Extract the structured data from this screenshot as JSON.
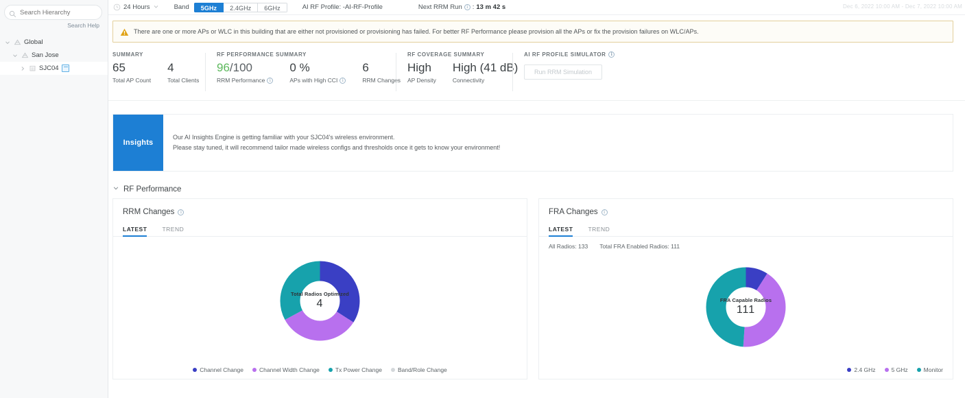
{
  "sidebar": {
    "search": {
      "placeholder": "Search Hierarchy",
      "value": ""
    },
    "search_help": "Search Help",
    "tree": [
      {
        "label": "Global",
        "icon": "site-icon",
        "expanded": true
      },
      {
        "label": "San Jose",
        "icon": "site-icon",
        "expanded": true
      },
      {
        "label": "SJC04",
        "icon": "building-icon",
        "expanded": false,
        "selected": true,
        "badge": "floor-plan-badge"
      }
    ]
  },
  "topbar": {
    "time_range": "24 Hours",
    "band_label": "Band",
    "bands": [
      {
        "label": "5GHz",
        "active": true
      },
      {
        "label": "2.4GHz",
        "active": false
      },
      {
        "label": "6GHz",
        "active": false
      }
    ],
    "profile": "AI RF Profile: -AI-RF-Profile",
    "next_run_label": "Next RRM Run",
    "next_run_sep": ":",
    "next_run_value": "13 m 42 s",
    "timestamp": "Dec 6, 2022 10:00 AM - Dec 7, 2022 10:00 AM"
  },
  "warning": {
    "text": "There are one or more APs or WLC in this building that are either not provisioned or provisioning has failed. For better RF Performance please provision all the APs or fix the provision failures on WLC/APs."
  },
  "summary": {
    "title": "SUMMARY",
    "metrics": [
      {
        "value": "65",
        "label": "Total AP Count"
      },
      {
        "value": "4",
        "label": "Total Clients"
      }
    ]
  },
  "rf_performance_summary": {
    "title": "RF PERFORMANCE SUMMARY",
    "metrics": [
      {
        "value": "96",
        "suffix": "/100",
        "label": "RRM Performance",
        "info": true
      },
      {
        "value": "0 %",
        "label": "APs with High CCI",
        "info": true
      },
      {
        "value": "6",
        "label": "RRM Changes",
        "info": false
      }
    ]
  },
  "rf_coverage_summary": {
    "title": "RF COVERAGE SUMMARY",
    "metrics": [
      {
        "value": "High",
        "label": "AP Density"
      },
      {
        "value": "High (41 dB)",
        "label": "Connectivity"
      }
    ]
  },
  "simulator": {
    "title": "AI RF PROFILE SIMULATOR",
    "button": "Run RRM Simulation",
    "disabled": true
  },
  "insights": {
    "tab_label": "Insights",
    "line1": "Our AI Insights Engine is getting familiar with your SJC04's wireless environment.",
    "line2": "Please stay tuned, it will recommend tailor made wireless configs and thresholds once it gets to know your environment!"
  },
  "section": {
    "title": "RF Performance"
  },
  "rrm_card": {
    "title": "RRM Changes",
    "tabs": [
      {
        "label": "LATEST",
        "active": true
      },
      {
        "label": "TREND",
        "active": false
      }
    ]
  },
  "fra_card": {
    "title": "FRA Changes",
    "tabs": [
      {
        "label": "LATEST",
        "active": true
      },
      {
        "label": "TREND",
        "active": false
      }
    ],
    "stats": [
      {
        "label": "All Radios:",
        "value": "133"
      },
      {
        "label": "Total FRA Enabled Radios:",
        "value": "111"
      }
    ]
  },
  "chart_data": [
    {
      "type": "pie",
      "id": "rrm-changes-donut",
      "title": "RRM Changes",
      "center_label": "Total Radios Optimized",
      "center_value": "4",
      "categories": [
        "Channel Change",
        "Channel Width Change",
        "Tx Power Change",
        "Band/Role Change"
      ],
      "values": [
        34,
        33,
        33,
        0
      ],
      "colors": [
        "#3a3fc4",
        "#b870ee",
        "#17a2ac",
        "#d4d8db"
      ],
      "legend_position": "bottom",
      "donut": true
    },
    {
      "type": "pie",
      "id": "fra-changes-donut",
      "title": "FRA Changes",
      "center_label": "FRA Capable Radios",
      "center_value": "111",
      "categories": [
        "2.4 GHz",
        "5 GHz",
        "Monitor"
      ],
      "values": [
        9,
        42,
        49
      ],
      "colors": [
        "#3a3fc4",
        "#b870ee",
        "#17a2ac"
      ],
      "legend_position": "bottom",
      "donut": true
    }
  ]
}
